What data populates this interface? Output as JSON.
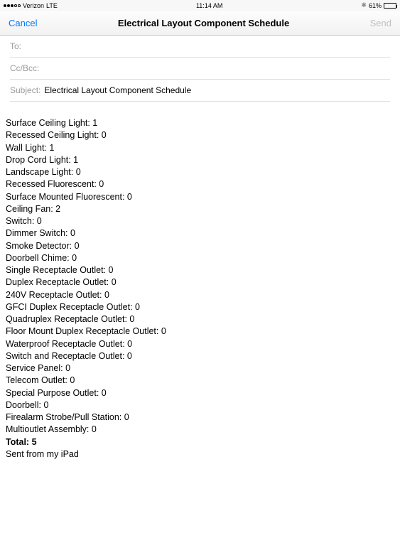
{
  "status": {
    "carrier": "Verizon",
    "network": "LTE",
    "time": "11:14 AM",
    "battery_pct": "61%"
  },
  "nav": {
    "cancel_label": "Cancel",
    "title": "Electrical Layout Component Schedule",
    "send_label": "Send"
  },
  "fields": {
    "to_label": "To:",
    "to_value": "",
    "cc_label": "Cc/Bcc:",
    "cc_value": "",
    "subject_label": "Subject:",
    "subject_value": "Electrical Layout Component Schedule"
  },
  "components": [
    {
      "name": "Surface Ceiling Light",
      "count": 1
    },
    {
      "name": "Recessed Ceiling Light",
      "count": 0
    },
    {
      "name": "Wall Light",
      "count": 1
    },
    {
      "name": "Drop Cord Light",
      "count": 1
    },
    {
      "name": "Landscape Light",
      "count": 0
    },
    {
      "name": "Recessed Fluorescent",
      "count": 0
    },
    {
      "name": "Surface Mounted Fluorescent",
      "count": 0
    },
    {
      "name": "Ceiling Fan",
      "count": 2
    },
    {
      "name": "Switch",
      "count": 0
    },
    {
      "name": "Dimmer Switch",
      "count": 0
    },
    {
      "name": "Smoke Detector",
      "count": 0
    },
    {
      "name": "Doorbell Chime",
      "count": 0
    },
    {
      "name": "Single Receptacle Outlet",
      "count": 0
    },
    {
      "name": "Duplex Receptacle Outlet",
      "count": 0
    },
    {
      "name": "240V Receptacle Outlet",
      "count": 0
    },
    {
      "name": "GFCI Duplex Receptacle Outlet",
      "count": 0
    },
    {
      "name": "Quadruplex Receptacle Outlet",
      "count": 0
    },
    {
      "name": "Floor Mount Duplex Receptacle Outlet",
      "count": 0
    },
    {
      "name": "Waterproof Receptacle Outlet",
      "count": 0
    },
    {
      "name": "Switch and Receptacle Outlet",
      "count": 0
    },
    {
      "name": "Service Panel",
      "count": 0
    },
    {
      "name": "Telecom Outlet",
      "count": 0
    },
    {
      "name": "Special Purpose Outlet",
      "count": 0
    },
    {
      "name": "Doorbell",
      "count": 0
    },
    {
      "name": "Firealarm Strobe/Pull Station",
      "count": 0
    },
    {
      "name": "Multioutlet Assembly",
      "count": 0
    }
  ],
  "total_label": "Total:",
  "total_value": 5,
  "signature": "Sent from my iPad"
}
